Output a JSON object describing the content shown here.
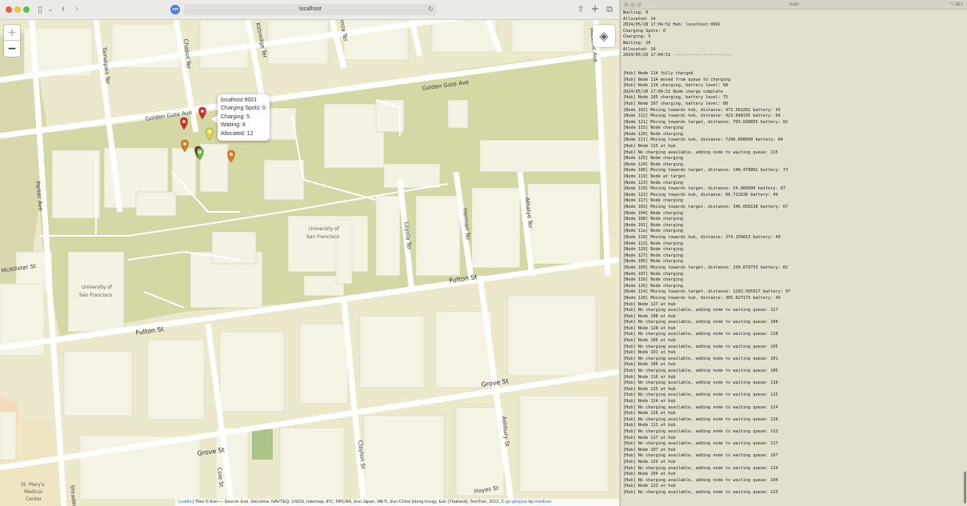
{
  "browser": {
    "address": "localhost",
    "site_badge": "API"
  },
  "map": {
    "streets": {
      "golden_gate_ave_top": "Golden Gate Ave",
      "golden_gate_ave_left": "Golden Gate Ave",
      "fulton_st_right": "Fulton St",
      "fulton_st_left": "Fulton St",
      "grove_st_right": "Grove St",
      "grove_st_left": "Grove St",
      "hayes_st": "Hayes St",
      "mcallister_st": "McAllister St",
      "parker_ave": "Parker Ave",
      "tamalpais_ter": "Tamalpais Ter",
      "chabot_ter": "Chabot Ter",
      "kittredge_ter": "Kittredge Ter",
      "annex_ter": "Anza Ter",
      "masonic_ave": "Masonic Ave",
      "loyola_ter": "Loyola Ter",
      "homer_ter": "Herman Ter",
      "athalye_ter": "Athalye Ter",
      "clayton_st": "Clayton St",
      "ashbury_st": "Ashbury St",
      "cole_st": "Cole St",
      "shrader_st": "Shrader St"
    },
    "pois": {
      "usf_main": [
        "University of",
        "San Francisco"
      ],
      "usf_lone": [
        "University of",
        "San Francisco"
      ],
      "st_marys": [
        "St. Mary's",
        "Medical",
        "Center"
      ]
    },
    "popup": {
      "host": "localhost:9001",
      "charging_spots": "Charging Spots: 0",
      "charging": "Charging: 5",
      "waiting": "Waiting: 8",
      "allocated": "Allocated: 12"
    },
    "attribution": {
      "leaflet": "Leaflet",
      "text": " | Tiles © Esri — Source: Esri, DeLorme, NAVTEQ, USGS, Intermap, iPC, NRCAN, Esri Japan, METI, Esri China (Hong Kong), Esri (Thailand), TomTom, 2012, © ",
      "goejson": "go-geojson",
      "by": " by ",
      "author": "monkuni"
    },
    "markers": [
      {
        "color": "#d22b2b",
        "label": "red"
      },
      {
        "color": "#d22b2b",
        "label": "red"
      },
      {
        "color": "#e8d838",
        "label": "yellow"
      },
      {
        "color": "#d97a1d",
        "label": "orange"
      },
      {
        "color": "#d97a1d",
        "label": "orange"
      },
      {
        "color": "#8b2020",
        "label": "dark-red"
      },
      {
        "color": "#5ac146",
        "label": "green"
      }
    ]
  },
  "terminal": {
    "title": "main",
    "shortcut": "⌥⌘1",
    "lines": [
      "Waiting: 8",
      "Allocated: 14",
      "2024/05/28 17:04:52 Hub: localhost:9002",
      "Charging Spots: 0",
      "Charging: 5",
      "Waiting: 10",
      "Allocated: 10",
      "2024/05/28 17:04:52 ------------------------",
      "",
      "",
      "[Hub] Node 114 fully charged",
      "[Hub] Node 114 moved from queue to charging",
      "[Hub] Node 114 charging, battery level: 68",
      "2024/05/28 17:04:52 Node charge complete",
      "[Hub] Node 105 charging, battery level: 75",
      "[Hub] Node 107 charging, battery level: 80",
      "[Node 102] Moving towards hub, distance: 473.563202 battery: 43",
      "[Node 112] Moving towards hub, distance: 423.048195 battery: 64",
      "[Node 121] Moving towards target, distance: 793.838855 battery: 82",
      "[Node 115] Node charging",
      "[Node 120] Node charging",
      "[Node 111] Moving towards hub, distance: 7296.608609 battery: 64",
      "[Hub] Node 115 at hub",
      "[Hub] No charging available, adding node to waiting queue: 115",
      "[Node 125] Node charging",
      "[Node 124] Node charging",
      "[Node 106] Moving towards target, distance: 148.479862 battery: 73",
      "[Node 119] Node at target",
      "[Node 123] Node charging",
      "[Node 118] Moving towards target, distance: 54.068990 battery: 67",
      "[Node 122] Moving towards hub, distance: 66.722636 battery: 49",
      "[Node 117] Node charging",
      "[Node 103] Moving towards target, distance: 346.058138 battery: 67",
      "[Node 104] Node charging",
      "[Node 108] Node charging",
      "[Node 101] Node charging",
      "[Node 11a] Node charging",
      "[Node 118] Moving towards hub, distance: 374.159813 battery: 49",
      "[Node 113] Node charging",
      "[Node 129] Node charging",
      "[Node 127] Node charging",
      "[Node 105] Node charging",
      "[Node 109] Moving towards target, distance: 130.870733 battery: 82",
      "[Node 107] Node charging",
      "[Node 116] Node charging",
      "[Node 126] Node charging",
      "[Node 114] Moving towards target, distance: 1203.565927 battery: 97",
      "[Node 128] Moving towards hub, distance: 305.027173 battery: 49",
      "[Hub] Node 127 at hub",
      "[Hub] No charging available, adding node to waiting queue: 127",
      "[Hub] Node 108 at hub",
      "[Hub] No charging available, adding node to waiting queue: 108",
      "[Hub] Node 128 at hub",
      "[Hub] No charging available, adding node to waiting queue: 128",
      "[Hub] Node 105 at hub",
      "[Hub] No charging available, adding node to waiting queue: 105",
      "[Hub] Node 101 at hub",
      "[Hub] No charging available, adding node to waiting queue: 101",
      "[Hub] Node 106 at hub",
      "[Hub] No charging available, adding node to waiting queue: 106",
      "[Hub] Node 116 at hub",
      "[Hub] No charging available, adding node to waiting queue: 116",
      "[Hub] Node 125 at hub",
      "[Hub] No charging available, adding node to waiting queue: 125",
      "[Hub] Node 124 at hub",
      "[Hub] No charging available, adding node to waiting queue: 124",
      "[Hub] Node 126 at hub",
      "[Hub] No charging available, adding node to waiting queue: 126",
      "[Hub] Node 113 at hub",
      "[Hub] No charging available, adding node to waiting queue: 113",
      "[Hub] Node 117 at hub",
      "[Hub] No charging available, adding node to waiting queue: 117",
      "[Hub] Node 107 at hub",
      "[Hub] No charging available, adding node to waiting queue: 107",
      "[Hub] Node 129 at hub",
      "[Hub] No charging available, adding node to waiting queue: 129",
      "[Hub] Node 104 at hub",
      "[Hub] No charging available, adding node to waiting queue: 104",
      "[Hub] Node 123 at hub",
      "[Hub] No charging available, adding node to waiting queue: 123"
    ]
  }
}
